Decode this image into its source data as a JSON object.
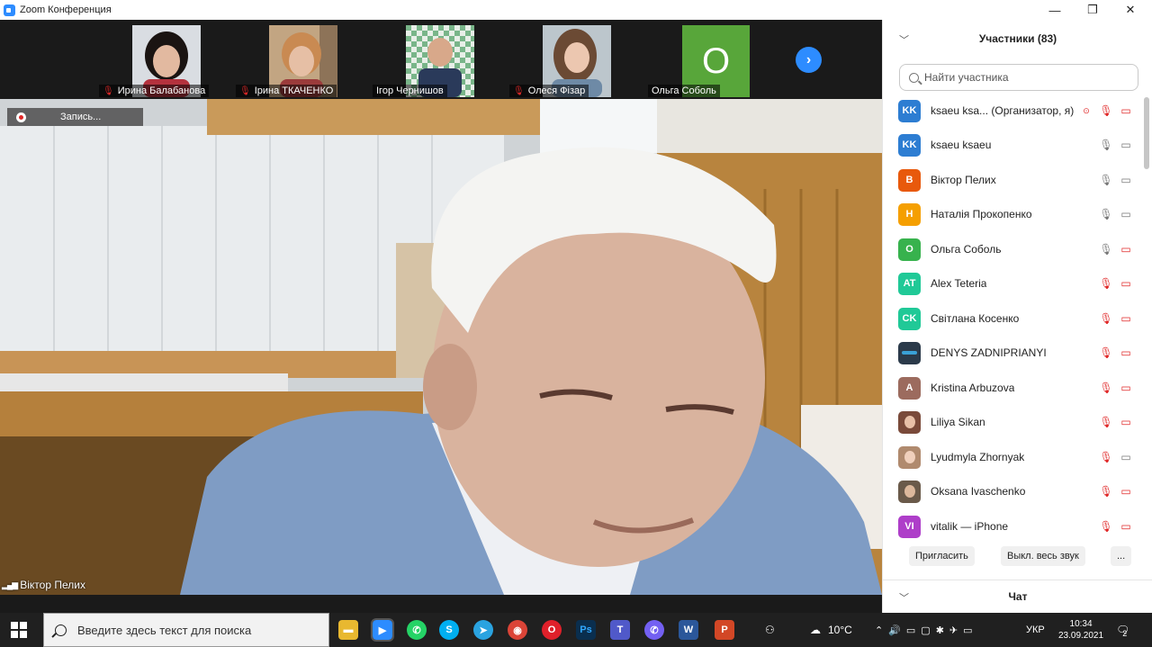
{
  "window": {
    "title": "Zoom Конференция",
    "controls": [
      "—",
      "❐",
      "✕"
    ]
  },
  "strip": {
    "thumbnails": [
      {
        "name": "Ирина Балабанова",
        "muted": true
      },
      {
        "name": "Ірина ТКАЧЕНКО",
        "muted": true
      },
      {
        "name": "Ігор Чернишов",
        "muted": false
      },
      {
        "name": "Олеся Фізар",
        "muted": true
      },
      {
        "name": "Ольга Соболь",
        "muted": false,
        "initial": "O"
      }
    ],
    "next_glyph": "›"
  },
  "video": {
    "recording_label": "Запись...",
    "speaker_name": "Віктор Пелих",
    "speaker_bars": "▂▄▆"
  },
  "panel": {
    "title": "Участники (83)",
    "search_placeholder": "Найти участника",
    "participants": [
      {
        "initials": "KK",
        "name": "ksaeu ksa...  (Организатор, я)",
        "color": "#2d7dd2",
        "mic": "red",
        "cam": "red",
        "rec": true
      },
      {
        "initials": "KK",
        "name": "ksaeu ksaeu",
        "color": "#2d7dd2",
        "mic": "gray",
        "cam": "gray"
      },
      {
        "initials": "B",
        "name": "Віктор Пелих",
        "color": "#e8590c",
        "mic": "gray",
        "cam": "gray"
      },
      {
        "initials": "H",
        "name": "Наталія Прокопенко",
        "color": "#f59f00",
        "mic": "gray",
        "cam": "gray"
      },
      {
        "initials": "O",
        "name": "Ольга Соболь",
        "color": "#37b24d",
        "mic": "gray",
        "cam": "red"
      },
      {
        "initials": "AT",
        "name": "Alex Teteria",
        "color": "#20c997",
        "mic": "red",
        "cam": "red"
      },
      {
        "initials": "CK",
        "name": "Світлана Косенко",
        "color": "#20c997",
        "mic": "red",
        "cam": "red"
      },
      {
        "initials": "",
        "name": "DENYS ZADNIPRIANYI",
        "color": "#2b3a4a",
        "mic": "red",
        "cam": "red"
      },
      {
        "initials": "A",
        "name": "Kristina Arbuzova",
        "color": "#9c6b5e",
        "mic": "red",
        "cam": "red"
      },
      {
        "initials": "",
        "name": "Liliya Sikan",
        "color": "#7a4a3a",
        "mic": "red",
        "cam": "red"
      },
      {
        "initials": "",
        "name": "Lyudmyla Zhornyak",
        "color": "#b08a6e",
        "mic": "red",
        "cam": "gray"
      },
      {
        "initials": "",
        "name": "Oksana Ivaschenko",
        "color": "#6a5a4a",
        "mic": "red",
        "cam": "red"
      },
      {
        "initials": "VI",
        "name": "vitalik — iPhone",
        "color": "#ae3ec9",
        "mic": "red",
        "cam": "red"
      }
    ],
    "buttons": {
      "invite": "Пригласить",
      "mute_all": "Выкл. весь звук",
      "more": "..."
    },
    "chat_title": "Чат"
  },
  "taskbar": {
    "search_placeholder": "Введите здесь текст для поиска",
    "weather": "10°C",
    "language": "УКР",
    "time": "10:34",
    "date": "23.09.2021",
    "notifications": "2"
  }
}
